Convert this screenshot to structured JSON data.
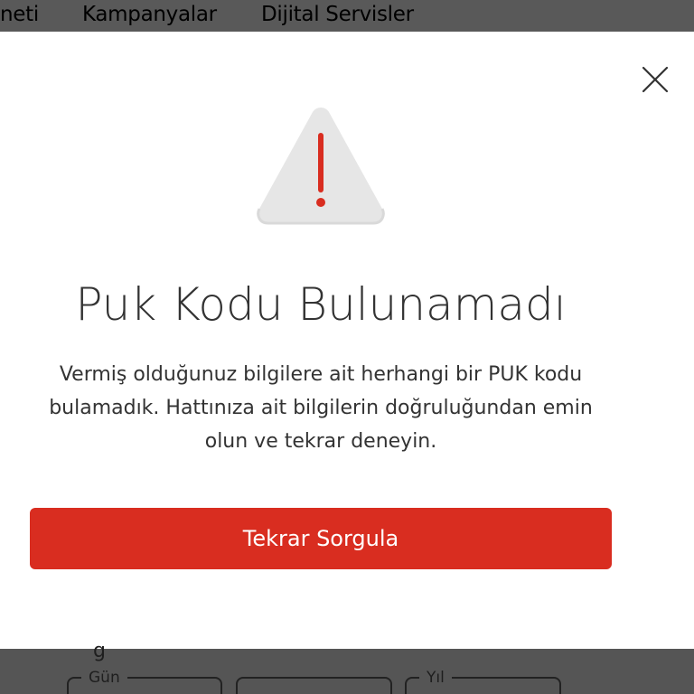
{
  "nav": {
    "items": [
      "neti",
      "Kampanyalar",
      "Dijital Servisler"
    ]
  },
  "modal": {
    "title": "Puk Kodu Bulunamadı",
    "message": "Vermiş olduğunuz bilgilere ait herhangi bir PUK kodu bulamadık. Hattınıza ait bilgilerin doğruluğundan emin olun ve tekrar deneyin.",
    "button_label": "Tekrar Sorgula",
    "close_icon": "close-icon",
    "warning_icon": "warning-icon"
  },
  "form": {
    "partial_text": "g",
    "day_label": "Gün",
    "year_label": "Yıl"
  },
  "colors": {
    "accent": "#d92d20",
    "overlay": "#555555",
    "warning_bg": "#e6e6e6"
  }
}
